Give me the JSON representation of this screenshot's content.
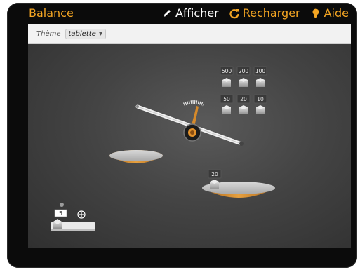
{
  "app": {
    "title": "Balance"
  },
  "menu": {
    "show": "Afficher",
    "reload": "Recharger",
    "help": "Aide"
  },
  "theme": {
    "label": "Thème",
    "value": "tablette"
  },
  "weights_stock": [
    "500",
    "200",
    "100",
    "50",
    "20",
    "10"
  ],
  "pan_weight": "20",
  "counter": {
    "value": "5"
  },
  "colors": {
    "accent": "#f5a623",
    "pan": "#d68a2a"
  }
}
